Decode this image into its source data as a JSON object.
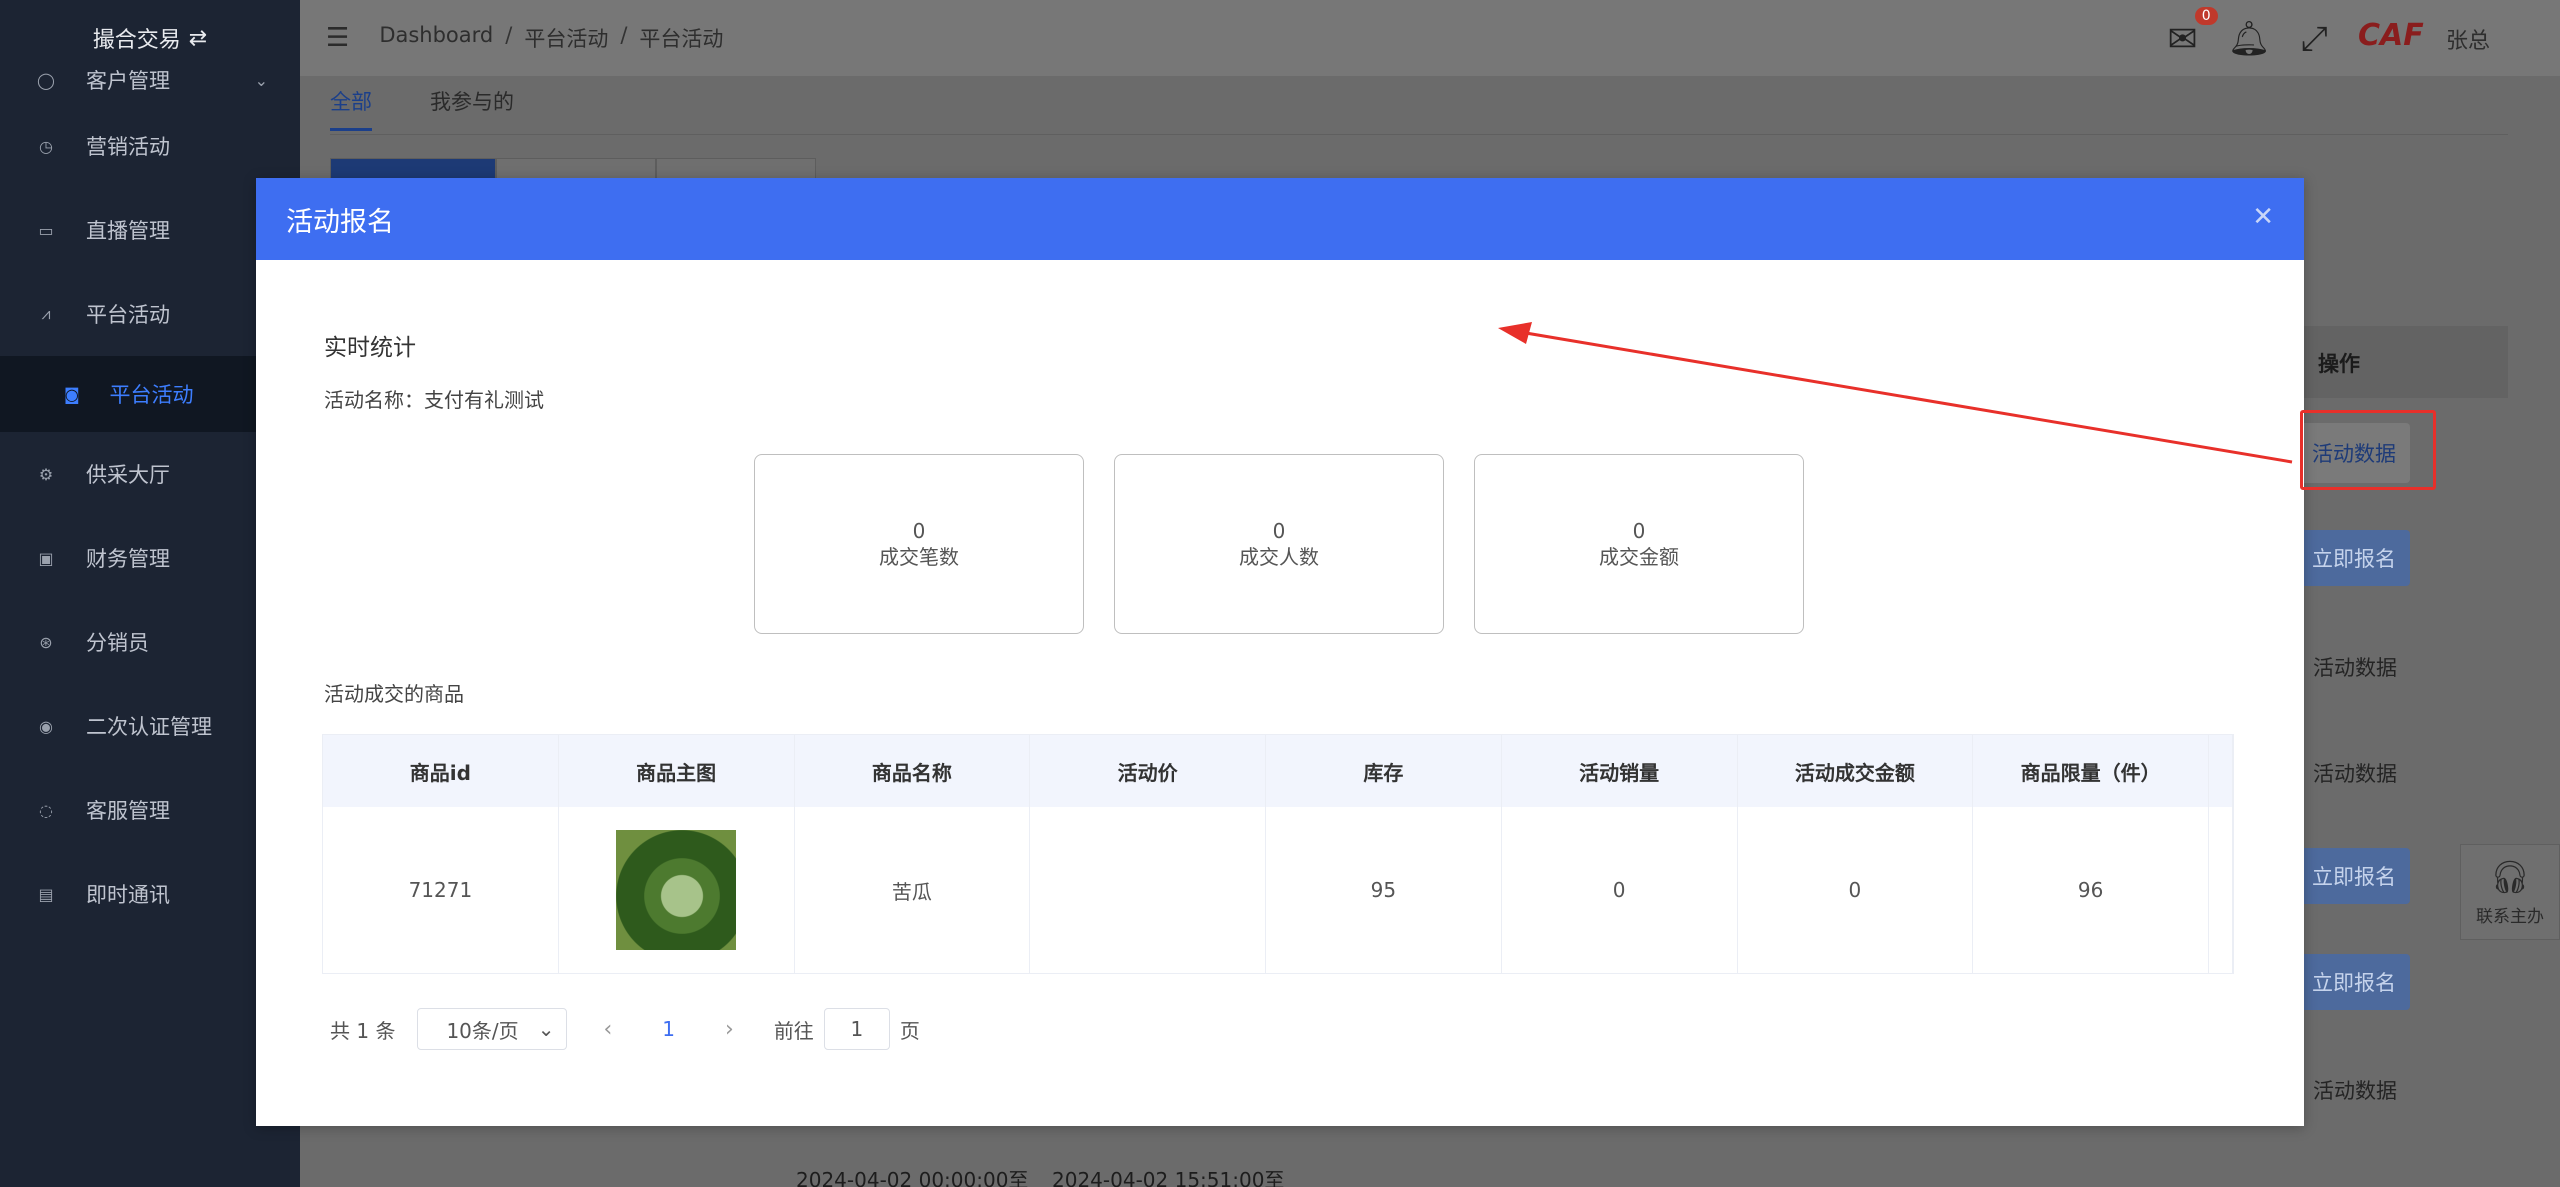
{
  "sidebar": {
    "top_label": "撮合交易",
    "items": [
      {
        "label": "客户管理",
        "icon": "user-icon"
      },
      {
        "label": "营销活动",
        "icon": "compass-icon"
      },
      {
        "label": "直播管理",
        "icon": "video-icon"
      },
      {
        "label": "平台活动",
        "icon": "chart-icon"
      },
      {
        "label": "供采大厅",
        "icon": "gear-icon"
      },
      {
        "label": "财务管理",
        "icon": "briefcase-icon"
      },
      {
        "label": "分销员",
        "icon": "network-icon"
      },
      {
        "label": "二次认证管理",
        "icon": "eye-icon"
      },
      {
        "label": "客服管理",
        "icon": "chat-icon"
      },
      {
        "label": "即时通讯",
        "icon": "message-icon"
      }
    ],
    "sub_item": {
      "label": "平台活动",
      "icon": "camera-icon"
    }
  },
  "header": {
    "breadcrumb": [
      "Dashboard",
      "平台活动",
      "平台活动"
    ],
    "mail_badge": "0",
    "logo_text": "CAF",
    "user_name": "张总"
  },
  "page": {
    "tabs": [
      "全部",
      "我参与的"
    ],
    "table_op_header": "操作",
    "op_buttons": [
      "活动数据",
      "立即报名",
      "活动数据",
      "活动数据",
      "立即报名",
      "立即报名",
      "活动数据"
    ],
    "bottom_row": [
      "2024-04-02 00:00:00至",
      "2024-04-02 15:51:00至"
    ],
    "contact_label": "联系主办"
  },
  "modal": {
    "title": "活动报名",
    "section_stats": "实时统计",
    "activity_name": "活动名称：支付有礼测试",
    "stats": [
      {
        "value": "0",
        "label": "成交笔数"
      },
      {
        "value": "0",
        "label": "成交人数"
      },
      {
        "value": "0",
        "label": "成交金额"
      }
    ],
    "section_goods": "活动成交的商品",
    "table": {
      "headers": [
        "商品id",
        "商品主图",
        "商品名称",
        "活动价",
        "库存",
        "活动销量",
        "活动成交金额",
        "商品限量（件）"
      ],
      "rows": [
        {
          "id": "71271",
          "image": "bitter-melon",
          "name": "苦瓜",
          "price": "",
          "stock": "95",
          "sales": "0",
          "amount": "0",
          "limit": "96"
        }
      ]
    },
    "pager": {
      "total": "共 1 条",
      "page_size": "10条/页",
      "current": "1",
      "goto_prefix": "前往",
      "goto_value": "1",
      "goto_suffix": "页"
    }
  },
  "colors": {
    "modal_header": "#3e6ef1",
    "annotation": "#e8302a",
    "sidebar_bg": "#1c2433"
  }
}
